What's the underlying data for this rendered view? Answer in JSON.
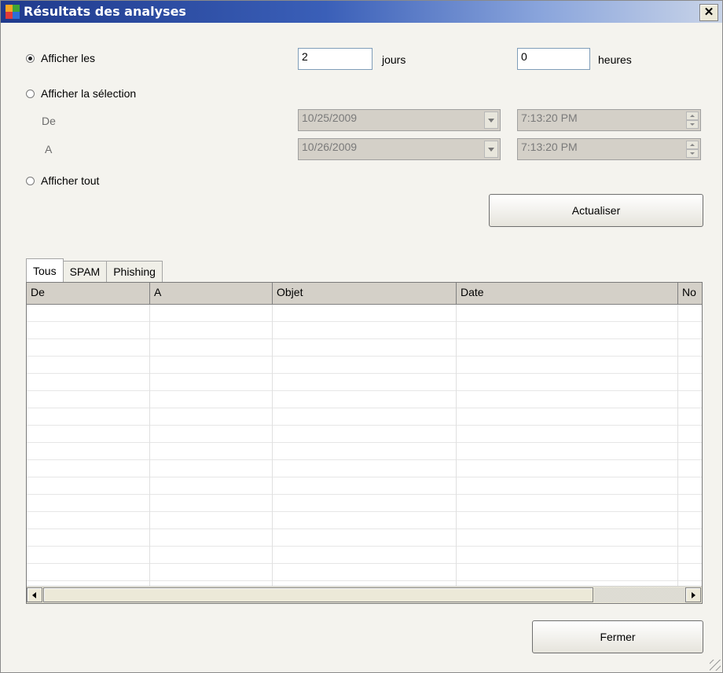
{
  "window": {
    "title": "Résultats des analyses",
    "close_glyph": "✕"
  },
  "filters": {
    "show_last_label": "Afficher les",
    "show_last_selected": true,
    "days_value": "2",
    "days_unit": "jours",
    "hours_value": "0",
    "hours_unit": "heures",
    "show_selection_label": "Afficher la sélection",
    "from_label": "De",
    "to_label": "A",
    "from_date": "10/25/2009",
    "to_date": "10/26/2009",
    "from_time": "7:13:20 PM",
    "to_time": "7:13:20 PM",
    "show_all_label": "Afficher tout",
    "refresh_label": "Actualiser"
  },
  "tabs": [
    {
      "label": "Tous",
      "active": true
    },
    {
      "label": "SPAM",
      "active": false
    },
    {
      "label": "Phishing",
      "active": false
    }
  ],
  "table": {
    "columns": [
      "De",
      "A",
      "Objet",
      "Date",
      "No"
    ],
    "rows": []
  },
  "footer": {
    "close_label": "Fermer"
  },
  "colors": {
    "titlebar_start": "#1f3a8c",
    "titlebar_end": "#c9d4e8",
    "window_bg": "#f4f3ee"
  }
}
